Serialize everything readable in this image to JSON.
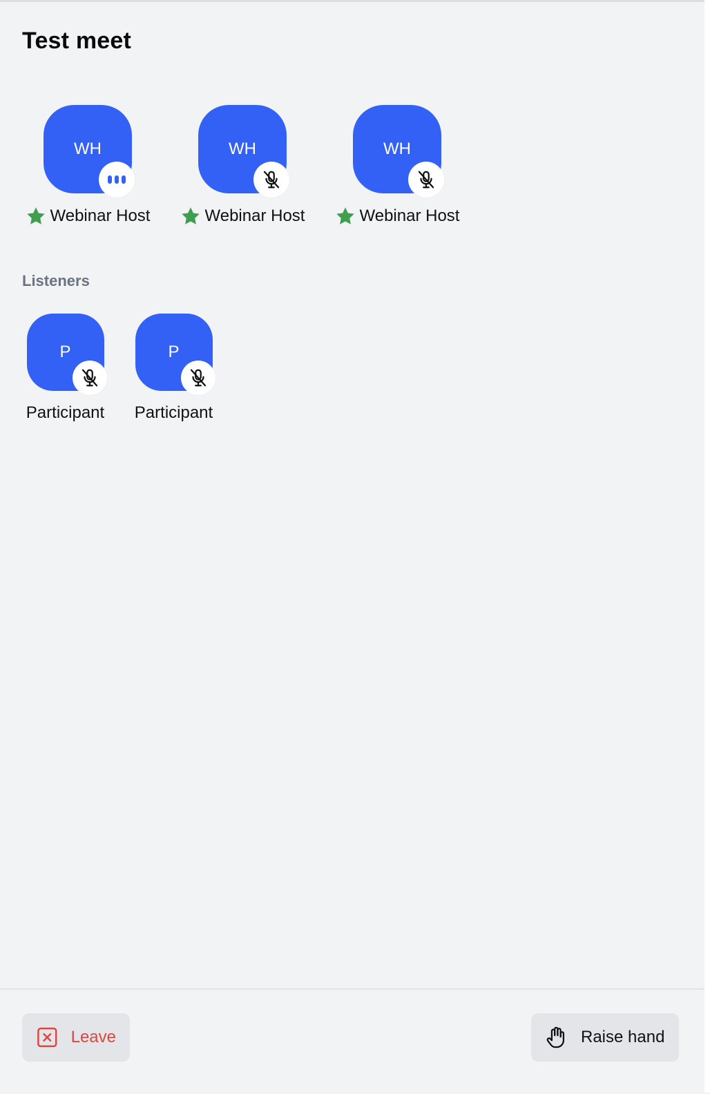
{
  "meeting": {
    "title": "Test meet"
  },
  "hosts": [
    {
      "initials": "WH",
      "name": "Webinar Host",
      "status_icon": "speaking-dots-icon"
    },
    {
      "initials": "WH",
      "name": "Webinar Host",
      "status_icon": "mic-off-icon"
    },
    {
      "initials": "WH",
      "name": "Webinar Host",
      "status_icon": "mic-off-icon"
    }
  ],
  "listeners_section": {
    "label": "Listeners"
  },
  "listeners": [
    {
      "initials": "P",
      "name": "Participant",
      "status_icon": "mic-off-icon"
    },
    {
      "initials": "P",
      "name": "Participant",
      "status_icon": "mic-off-icon"
    }
  ],
  "footer": {
    "leave_label": "Leave",
    "raise_hand_label": "Raise hand"
  },
  "colors": {
    "avatar": "#3461f5",
    "host_star": "#3f9f4f",
    "leave": "#d9473f",
    "background": "#f2f3f5"
  }
}
